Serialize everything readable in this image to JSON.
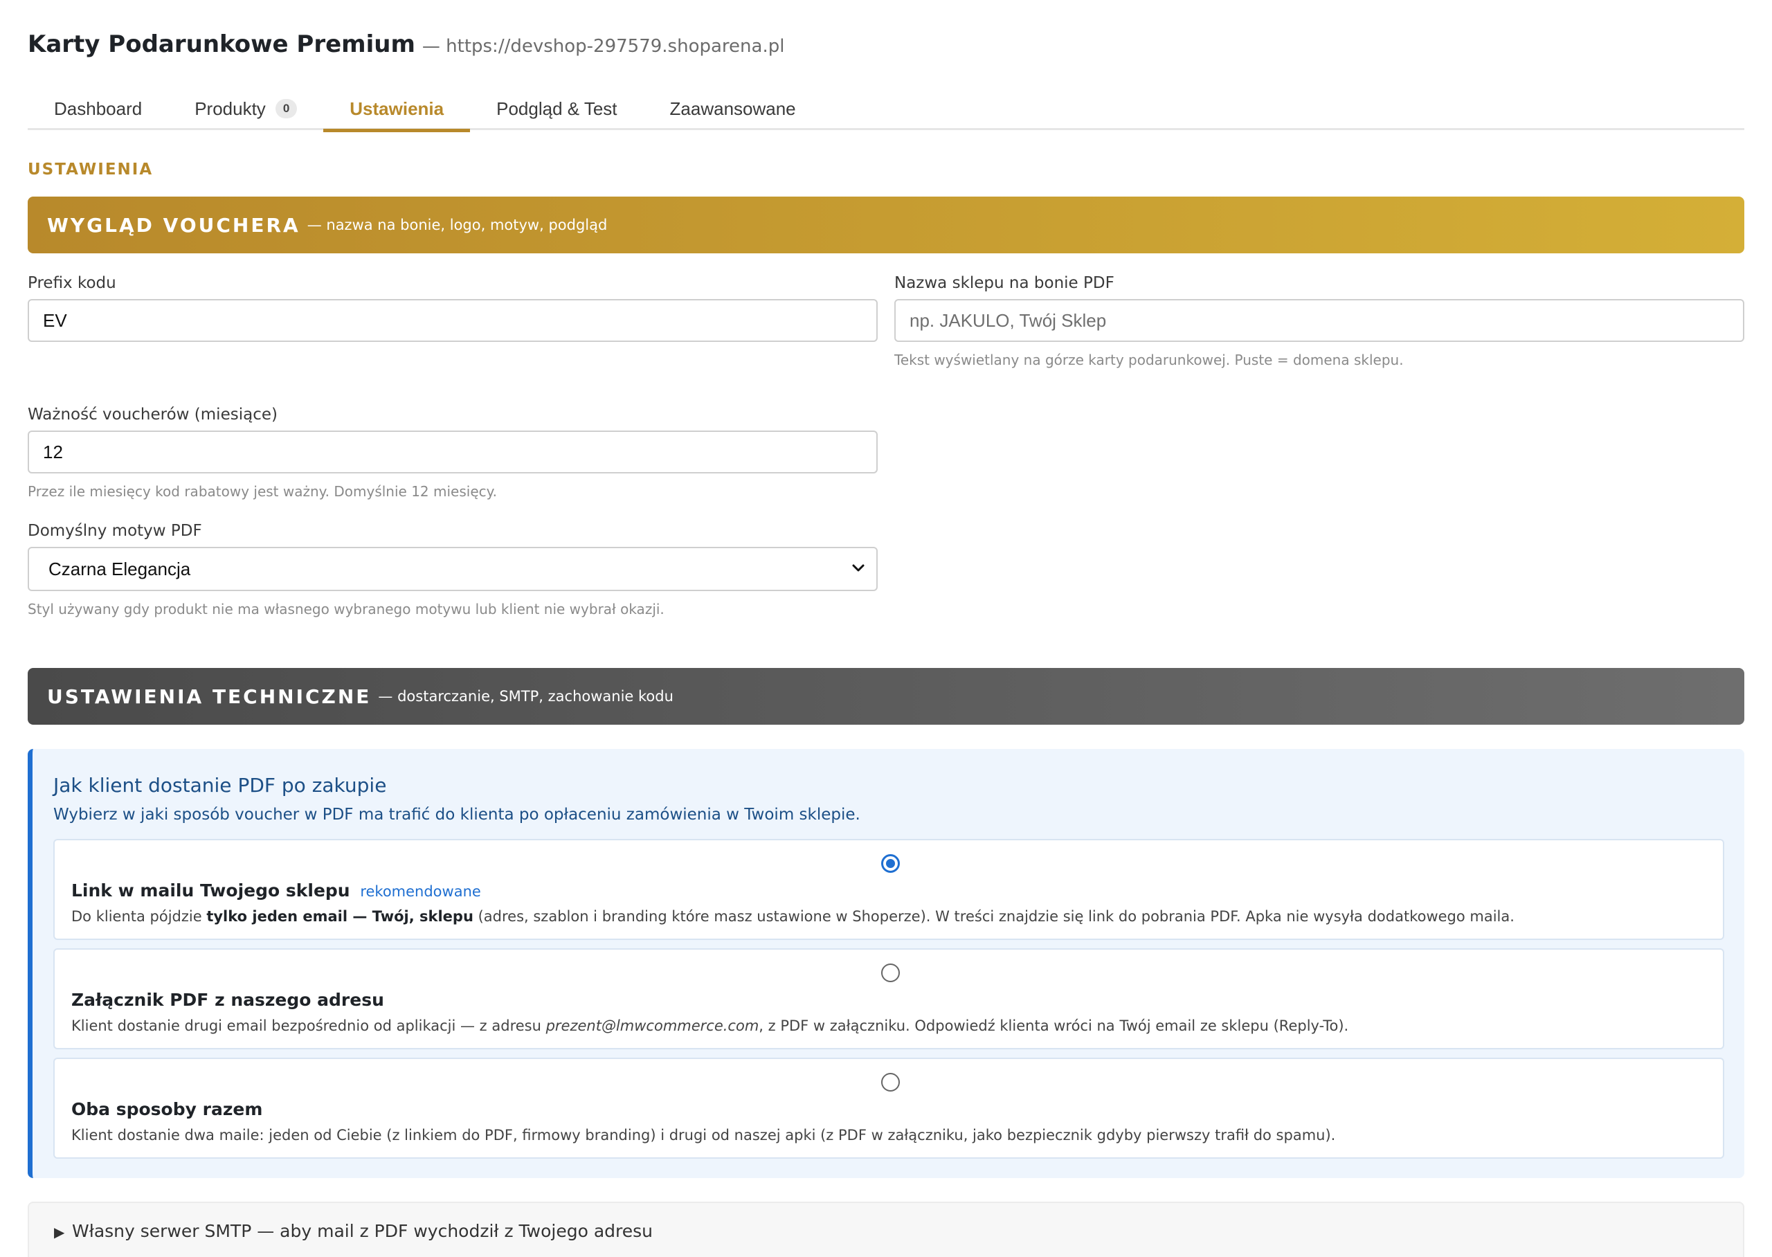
{
  "header": {
    "title": "Karty Podarunkowe Premium",
    "url": "— https://devshop-297579.shoparena.pl"
  },
  "tabs": [
    {
      "label": "Dashboard"
    },
    {
      "label": "Produkty",
      "badge": "0"
    },
    {
      "label": "Ustawienia",
      "active": true
    },
    {
      "label": "Podgląd & Test"
    },
    {
      "label": "Zaawansowane"
    }
  ],
  "section_label": "USTAWIENIA",
  "voucher_banner": {
    "title": "WYGLĄD VOUCHERA",
    "subtitle": "— nazwa na bonie, logo, motyw, podgląd"
  },
  "fields": {
    "prefix": {
      "label": "Prefix kodu",
      "value": "EV"
    },
    "shop_name": {
      "label": "Nazwa sklepu na bonie PDF",
      "placeholder": "np. JAKULO, Twój Sklep",
      "help": "Tekst wyświetlany na górze karty podarunkowej. Puste = domena sklepu."
    },
    "validity": {
      "label": "Ważność voucherów (miesiące)",
      "value": "12",
      "help": "Przez ile miesięcy kod rabatowy jest ważny. Domyślnie 12 miesięcy."
    },
    "theme": {
      "label": "Domyślny motyw PDF",
      "value": "Czarna Elegancja",
      "help": "Styl używany gdy produkt nie ma własnego wybranego motywu lub klient nie wybrał okazji."
    }
  },
  "tech_banner": {
    "title": "USTAWIENIA TECHNICZNE",
    "subtitle": "— dostarczanie, SMTP, zachowanie kodu"
  },
  "delivery": {
    "title": "Jak klient dostanie PDF po zakupie",
    "subtitle": "Wybierz w jaki sposób voucher w PDF ma trafić do klienta po opłaceniu zamówienia w Twoim sklepie.",
    "options": [
      {
        "title": "Link w mailu Twojego sklepu",
        "tag": "rekomendowane",
        "checked": true,
        "desc_pre": "Do klienta pójdzie ",
        "desc_bold": "tylko jeden email — Twój, sklepu",
        "desc_post": " (adres, szablon i branding które masz ustawione w Shoperze). W treści znajdzie się link do pobrania PDF. Apka nie wysyła dodatkowego maila."
      },
      {
        "title": "Załącznik PDF z naszego adresu",
        "checked": false,
        "desc_pre": "Klient dostanie drugi email bezpośrednio od aplikacji — z adresu ",
        "desc_italic": "prezent@lmwcommerce.com",
        "desc_post": ", z PDF w załączniku. Odpowiedź klienta wróci na Twój email ze sklepu (Reply-To)."
      },
      {
        "title": "Oba sposoby razem",
        "checked": false,
        "desc": "Klient dostanie dwa maile: jeden od Ciebie (z linkiem do PDF, firmowy branding) i drugi od naszej apki (z PDF w załączniku, jako bezpiecznik gdyby pierwszy trafił do spamu)."
      }
    ]
  },
  "smtp": {
    "label": "Własny serwer SMTP — aby mail z PDF wychodził z Twojego adresu"
  },
  "colors": {
    "accent_gold": "#b8892b",
    "accent_blue": "#1f6fd1",
    "tech_gray": "#4a4a4a"
  }
}
